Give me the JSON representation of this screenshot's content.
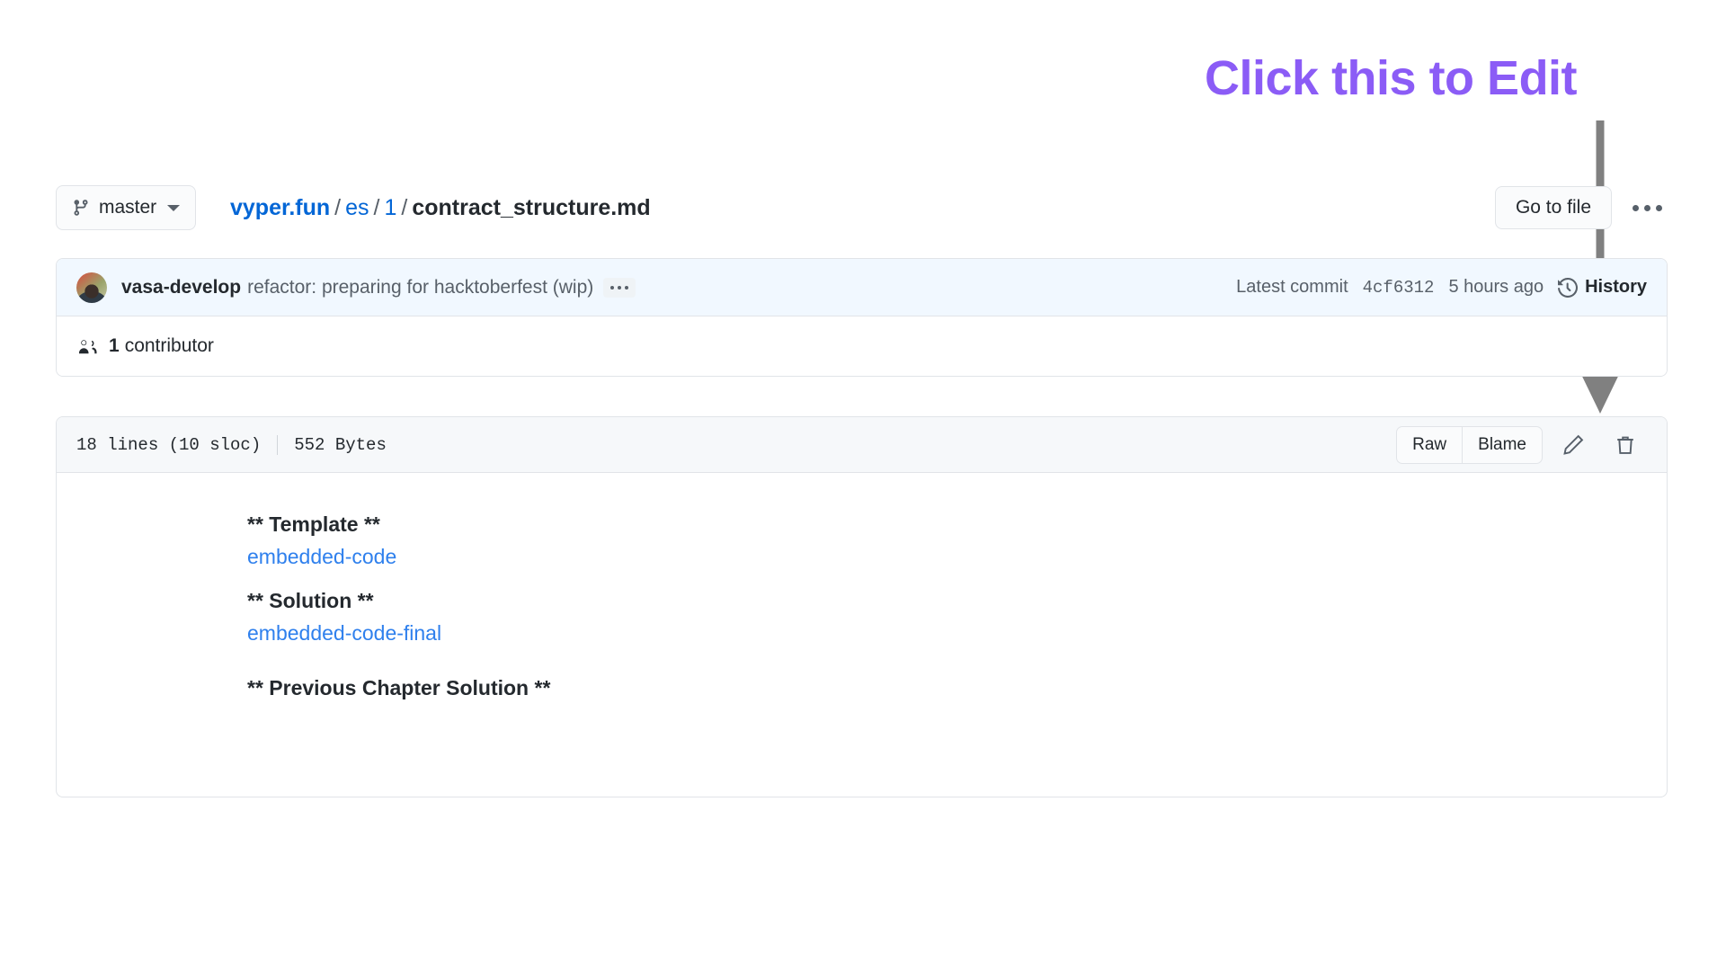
{
  "annotation": {
    "text": "Click this to Edit",
    "color": "#8b5cf6",
    "arrow_color": "#808080",
    "arrow_points_to": "edit-pencil-icon"
  },
  "topbar": {
    "branch_button": {
      "label": "master",
      "icon": "git-branch-icon",
      "caret": "chevron-down-icon"
    },
    "breadcrumb": {
      "repo": "vyper.fun",
      "separator": "/",
      "segments": [
        "es",
        "1"
      ],
      "file": "contract_structure.md"
    },
    "go_to_file_label": "Go to file",
    "kebab_menu": "more-options-icon"
  },
  "info_box": {
    "commit": {
      "author": "vasa-develop",
      "message": "refactor: preparing for hacktoberfest (wip)",
      "expand_badge": "ellipsis-badge",
      "latest_commit_label": "Latest commit",
      "sha": "4cf6312",
      "time": "5 hours ago",
      "history_label": "History",
      "history_icon": "history-clock-icon",
      "row_background": "#f1f8ff"
    },
    "contributors": {
      "icon": "people-icon",
      "count": "1",
      "label": "contributor"
    }
  },
  "file_box": {
    "toolbar": {
      "lines": "18 lines (10 sloc)",
      "size": "552 Bytes",
      "raw_label": "Raw",
      "blame_label": "Blame",
      "edit_icon": "pencil-icon",
      "delete_icon": "trash-icon"
    },
    "content": {
      "blocks": [
        {
          "type": "heading",
          "text": "** Template **"
        },
        {
          "type": "link",
          "text": "embedded-code"
        },
        {
          "type": "heading",
          "text": "** Solution **"
        },
        {
          "type": "link",
          "text": "embedded-code-final"
        },
        {
          "type": "heading",
          "text": "** Previous Chapter Solution **"
        }
      ],
      "heading_color": "#24292e",
      "link_color": "#2f80ed"
    }
  }
}
